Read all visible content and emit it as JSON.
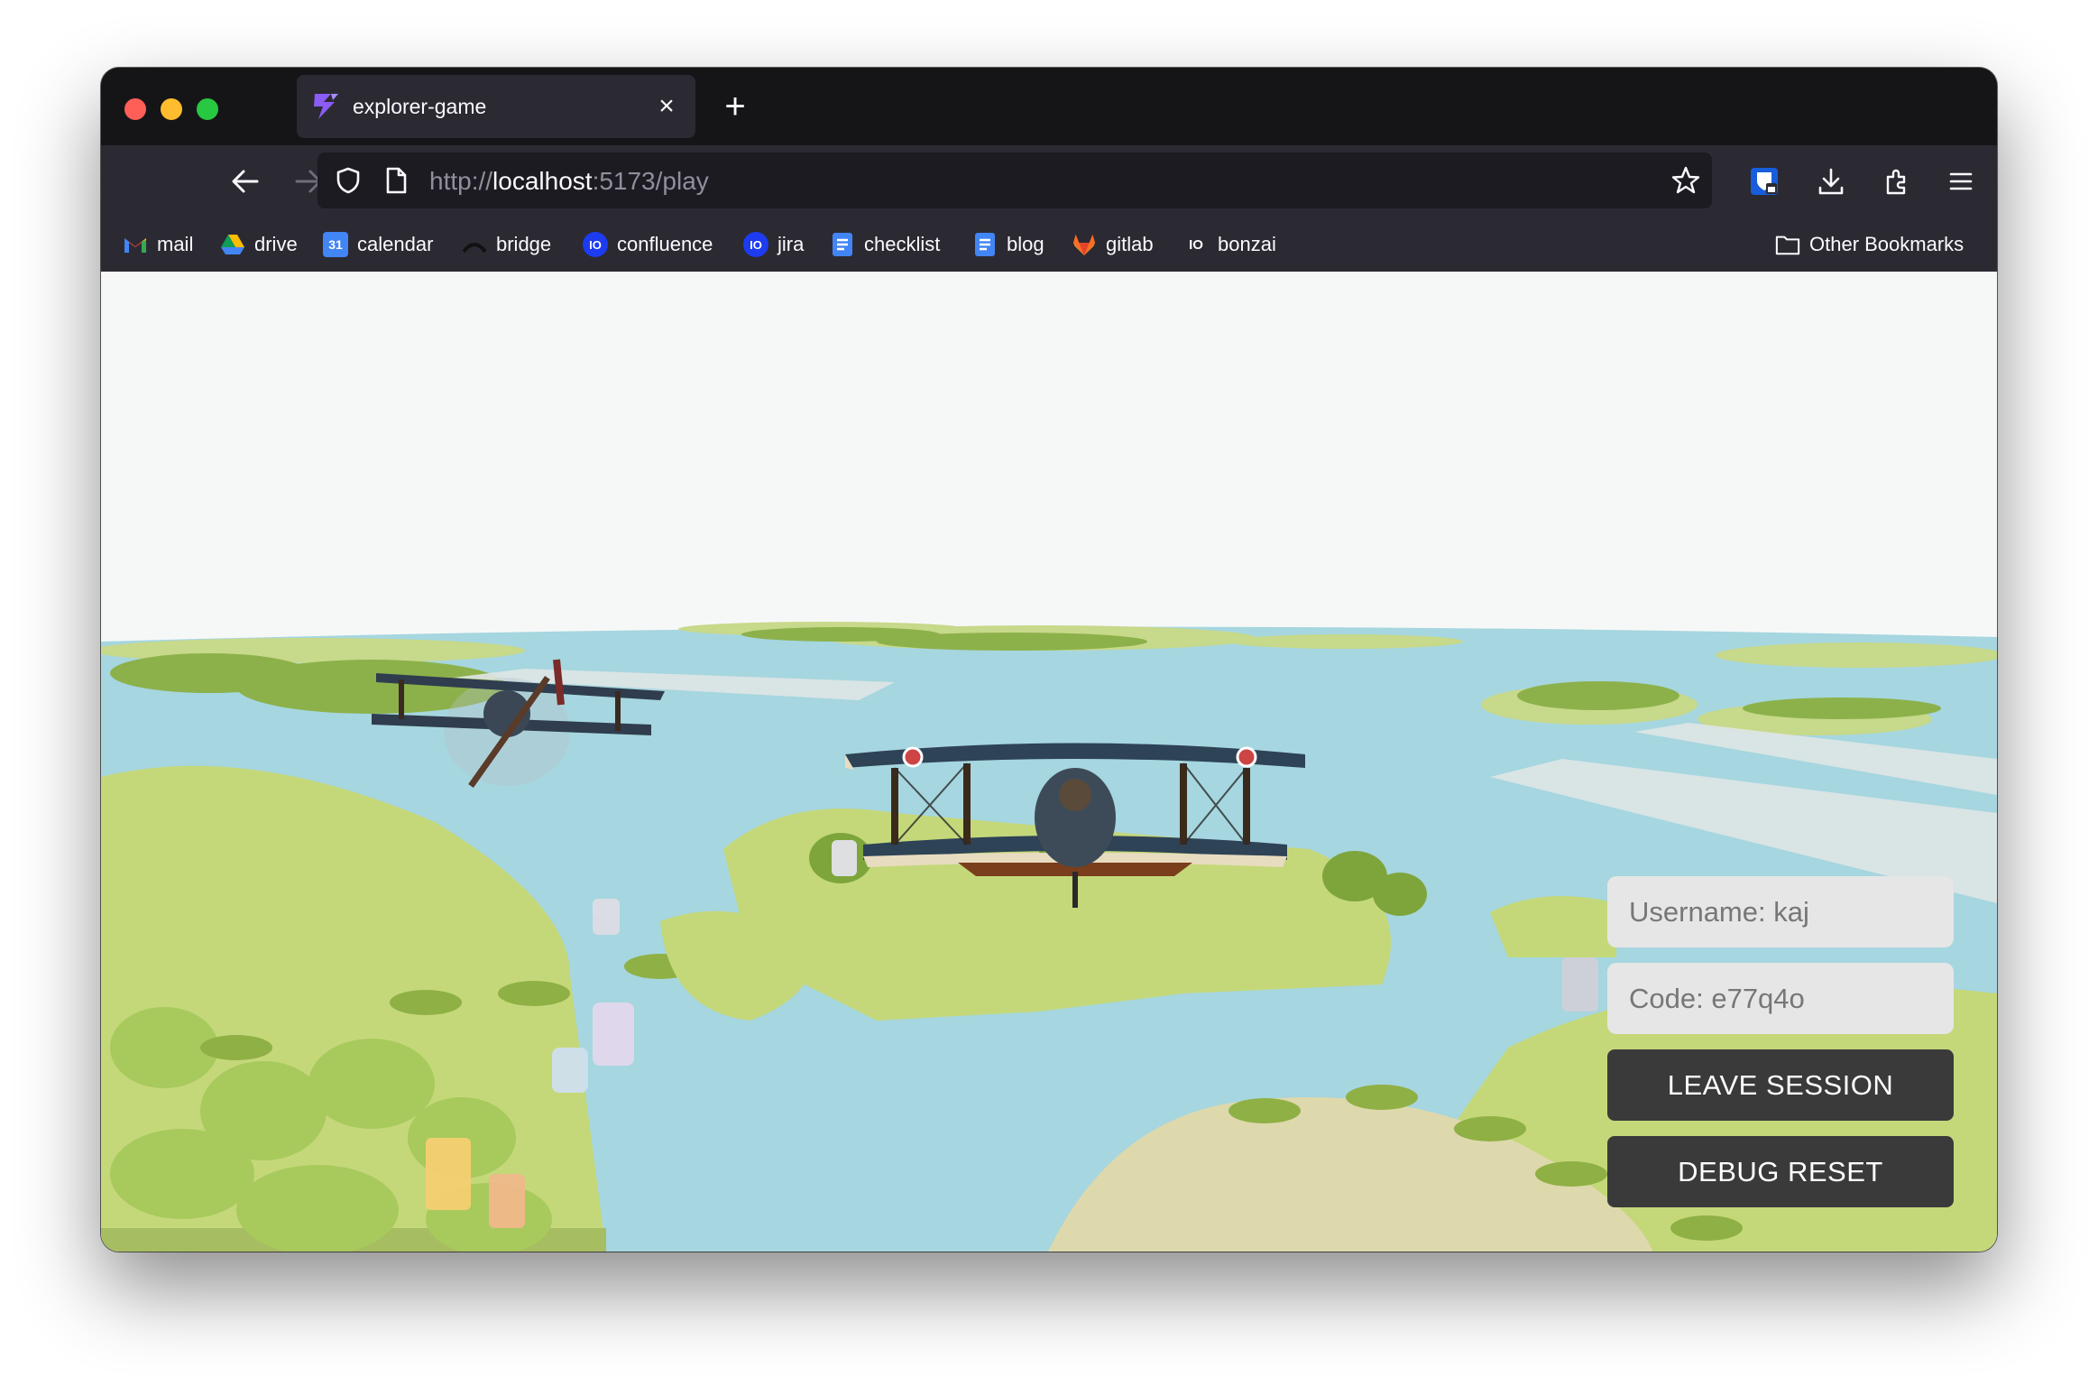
{
  "browser": {
    "tab": {
      "title": "explorer-game",
      "close_label": "×",
      "icon": "lightning-icon"
    },
    "new_tab_label": "+",
    "url": {
      "scheme": "http://",
      "host": "localhost",
      "rest": ":5173/play"
    },
    "bookmarks": [
      {
        "label": "mail",
        "icon": "gmail-icon"
      },
      {
        "label": "drive",
        "icon": "drive-icon"
      },
      {
        "label": "calendar",
        "icon": "calendar-icon"
      },
      {
        "label": "bridge",
        "icon": "bridge-icon"
      },
      {
        "label": "confluence",
        "icon": "io-icon"
      },
      {
        "label": "jira",
        "icon": "io-icon"
      },
      {
        "label": "checklist",
        "icon": "doc-icon"
      },
      {
        "label": "blog",
        "icon": "doc-icon"
      },
      {
        "label": "gitlab",
        "icon": "gitlab-icon"
      },
      {
        "label": "bonzai",
        "icon": "io-icon"
      }
    ],
    "other_bookmarks": "Other Bookmarks",
    "calendar_day": "31"
  },
  "game": {
    "username_field": "Username: kaj",
    "code_field": "Code: e77q4o",
    "leave_button": "LEAVE SESSION",
    "debug_button": "DEBUG RESET"
  },
  "colors": {
    "chrome_dark": "#151518",
    "toolbar": "#2b2a33",
    "sky": "#f6f8f8",
    "water": "#a6d6df",
    "island": "#c4d87a",
    "button_bg": "#3a3a3a",
    "field_bg": "#e6e6e6"
  }
}
